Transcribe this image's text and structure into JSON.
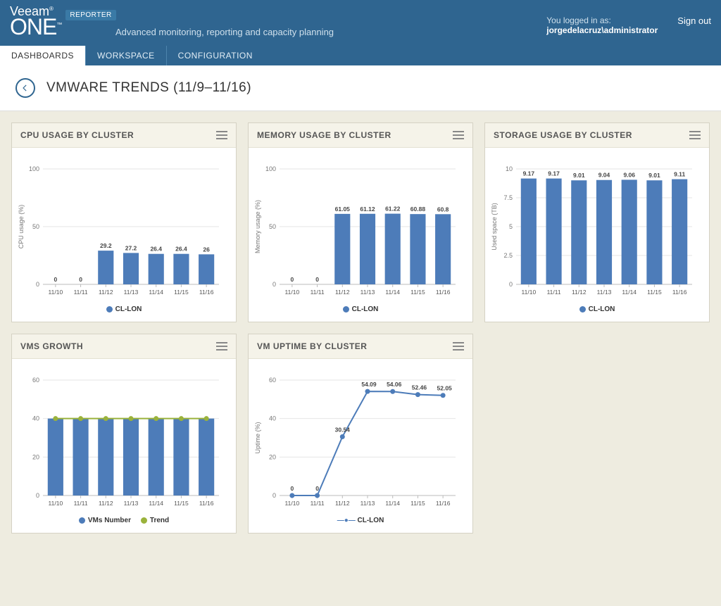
{
  "header": {
    "brand_top": "Veeam",
    "brand_main": "ONE",
    "brand_tm": "™",
    "brand_r": "®",
    "badge": "REPORTER",
    "tagline": "Advanced monitoring, reporting and capacity planning",
    "logged_in_as_label": "You logged in as:",
    "username": "jorgedelacruz\\administrator",
    "signout": "Sign out"
  },
  "tabs": [
    {
      "label": "DASHBOARDS",
      "active": true
    },
    {
      "label": "WORKSPACE",
      "active": false
    },
    {
      "label": "CONFIGURATION",
      "active": false
    }
  ],
  "page_title": "VMWARE TRENDS (11/9–11/16)",
  "dates": [
    "11/10",
    "11/11",
    "11/12",
    "11/13",
    "11/14",
    "11/15",
    "11/16"
  ],
  "legend_series": "CL-LON",
  "colors": {
    "bar": "#4d7cb9",
    "line": "#4d7cb9",
    "trend": "#9ab23b",
    "grid": "#e6e6e6",
    "axis": "#bbb"
  },
  "cards": {
    "cpu": {
      "title": "CPU USAGE BY CLUSTER",
      "ylabel": "CPU usage (%)"
    },
    "memory": {
      "title": "MEMORY USAGE BY CLUSTER",
      "ylabel": "Memory usage (%)"
    },
    "storage": {
      "title": "STORAGE USAGE BY CLUSTER",
      "ylabel": "Used space (TB)"
    },
    "vms": {
      "title": "VMS GROWTH",
      "legend1": "VMs Number",
      "legend2": "Trend"
    },
    "uptime": {
      "title": "VM UPTIME BY CLUSTER",
      "ylabel": "Uptime (%)"
    }
  },
  "chart_data": [
    {
      "id": "cpu",
      "type": "bar",
      "title": "CPU USAGE BY CLUSTER",
      "ylabel": "CPU usage (%)",
      "categories": [
        "11/10",
        "11/11",
        "11/12",
        "11/13",
        "11/14",
        "11/15",
        "11/16"
      ],
      "series": [
        {
          "name": "CL-LON",
          "values": [
            0,
            0,
            29.2,
            27.2,
            26.4,
            26.4,
            26
          ]
        }
      ],
      "ylim": [
        0,
        100
      ],
      "yticks": [
        0,
        50,
        100
      ]
    },
    {
      "id": "memory",
      "type": "bar",
      "title": "MEMORY USAGE BY CLUSTER",
      "ylabel": "Memory usage (%)",
      "categories": [
        "11/10",
        "11/11",
        "11/12",
        "11/13",
        "11/14",
        "11/15",
        "11/16"
      ],
      "series": [
        {
          "name": "CL-LON",
          "values": [
            0,
            0,
            61.05,
            61.12,
            61.22,
            60.88,
            60.8
          ]
        }
      ],
      "ylim": [
        0,
        100
      ],
      "yticks": [
        0,
        50,
        100
      ]
    },
    {
      "id": "storage",
      "type": "bar",
      "title": "STORAGE USAGE BY CLUSTER",
      "ylabel": "Used space (TB)",
      "categories": [
        "11/10",
        "11/11",
        "11/12",
        "11/13",
        "11/14",
        "11/15",
        "11/16"
      ],
      "series": [
        {
          "name": "CL-LON",
          "values": [
            9.17,
            9.17,
            9.01,
            9.04,
            9.06,
            9.01,
            9.11
          ]
        }
      ],
      "ylim": [
        0,
        10
      ],
      "yticks": [
        0,
        2.5,
        5,
        7.5,
        10
      ]
    },
    {
      "id": "vms",
      "type": "bar",
      "title": "VMS GROWTH",
      "ylabel": "",
      "categories": [
        "11/10",
        "11/11",
        "11/12",
        "11/13",
        "11/14",
        "11/15",
        "11/16"
      ],
      "series": [
        {
          "name": "VMs Number",
          "values": [
            40,
            40,
            40,
            40,
            40,
            40,
            40
          ]
        },
        {
          "name": "Trend",
          "values": [
            40,
            40,
            40,
            40,
            40,
            40,
            40
          ],
          "kind": "line"
        }
      ],
      "ylim": [
        0,
        60
      ],
      "yticks": [
        0,
        20,
        40,
        60
      ]
    },
    {
      "id": "uptime",
      "type": "line",
      "title": "VM UPTIME BY CLUSTER",
      "ylabel": "Uptime (%)",
      "categories": [
        "11/10",
        "11/11",
        "11/12",
        "11/13",
        "11/14",
        "11/15",
        "11/16"
      ],
      "series": [
        {
          "name": "CL-LON",
          "values": [
            0,
            0,
            30.54,
            54.09,
            54.06,
            52.46,
            52.05
          ]
        }
      ],
      "ylim": [
        0,
        60
      ],
      "yticks": [
        0,
        20,
        40,
        60
      ]
    }
  ]
}
